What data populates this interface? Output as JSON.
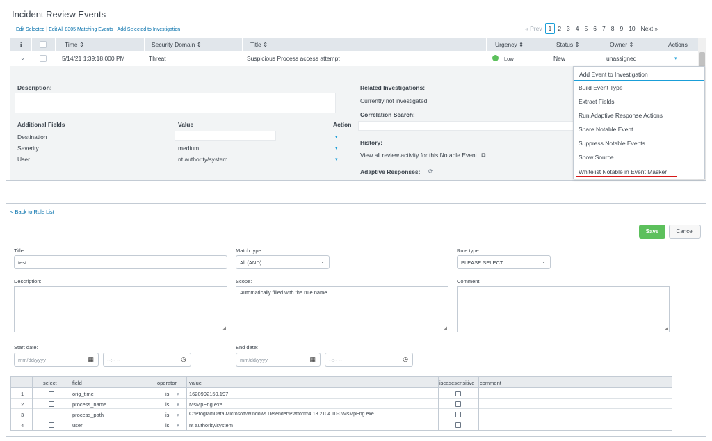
{
  "incident_review": {
    "title": "Incident Review Events",
    "actions": [
      "Edit Selected",
      "Edit All 8305 Matching Events",
      "Add Selected to Investigation"
    ],
    "pagination": {
      "prev": "« Prev",
      "pages": [
        "1",
        "2",
        "3",
        "4",
        "5",
        "6",
        "7",
        "8",
        "9",
        "10"
      ],
      "next": "Next »",
      "current": "1"
    },
    "columns": {
      "info": "i",
      "time": "Time ⇕",
      "security_domain": "Security Domain ⇕",
      "title": "Title ⇕",
      "urgency": "Urgency ⇕",
      "status": "Status ⇕",
      "owner": "Owner ⇕",
      "actions": "Actions"
    },
    "event": {
      "expand": "⌄",
      "time": "5/14/21 1:39:18.000 PM",
      "security_domain": "Threat",
      "title": "Suspicious Process access attempt",
      "urgency": "Low",
      "status": "New",
      "owner": "unassigned",
      "actions_caret": "▾"
    },
    "details": {
      "description_label": "Description:",
      "additional_fields_label": "Additional Fields",
      "value_label": "Value",
      "action_label": "Action",
      "fields": [
        {
          "name": "Destination",
          "value": ""
        },
        {
          "name": "Severity",
          "value": "medium"
        },
        {
          "name": "User",
          "value": "nt authority/system"
        }
      ],
      "field_caret": "▾",
      "related_investigations_label": "Related Investigations:",
      "related_investigations_value": "Currently not investigated.",
      "correlation_search_label": "Correlation Search:",
      "history_label": "History:",
      "history_link": "View all review activity for this Notable Event",
      "history_link_icon": "⧉",
      "adaptive_responses_label": "Adaptive Responses:",
      "refresh_icon": "⟳"
    },
    "menu_items": [
      "Add Event to Investigation",
      "Build Event Type",
      "Extract Fields",
      "Run Adaptive Response Actions",
      "Share Notable Event",
      "Suppress Notable Events",
      "Show Source",
      "Whitelist Notable in Event Masker"
    ]
  },
  "rule_editor": {
    "back_link": "< Back to Rule List",
    "save_label": "Save",
    "cancel_label": "Cancel",
    "title_label": "Title:",
    "title_value": "test",
    "match_type_label": "Match type:",
    "match_type_value": "All (AND)",
    "rule_type_label": "Rule type:",
    "rule_type_value": "PLEASE SELECT",
    "description_label": "Description:",
    "scope_label": "Scope:",
    "scope_value": "Automatically filled with the rule name",
    "comment_label": "Comment:",
    "start_date_label": "Start date:",
    "end_date_label": "End date:",
    "date_placeholder": "mm/dd/yyyy",
    "time_placeholder": "--:-- --",
    "calendar_icon": "▦",
    "clock_icon": "◷",
    "dropdown_caret": "⌄",
    "grid_columns": {
      "select": "select",
      "field": "field",
      "operator": "operator",
      "value": "value",
      "iscasesensitive": "iscasesensitive",
      "comment": "comment"
    },
    "grid_rows": [
      {
        "num": "1",
        "field": "orig_time",
        "operator": "is",
        "value": "1620992159.197"
      },
      {
        "num": "2",
        "field": "process_name",
        "operator": "is",
        "value": "MsMpEng.exe"
      },
      {
        "num": "3",
        "field": "process_path",
        "operator": "is",
        "value": "C:\\ProgramData\\Microsoft\\Windows Defender\\Platform\\4.18.2104.10-0\\MsMpEng.exe"
      },
      {
        "num": "4",
        "field": "user",
        "operator": "is",
        "value": "nt authority/system"
      }
    ],
    "operator_caret": "▾"
  }
}
